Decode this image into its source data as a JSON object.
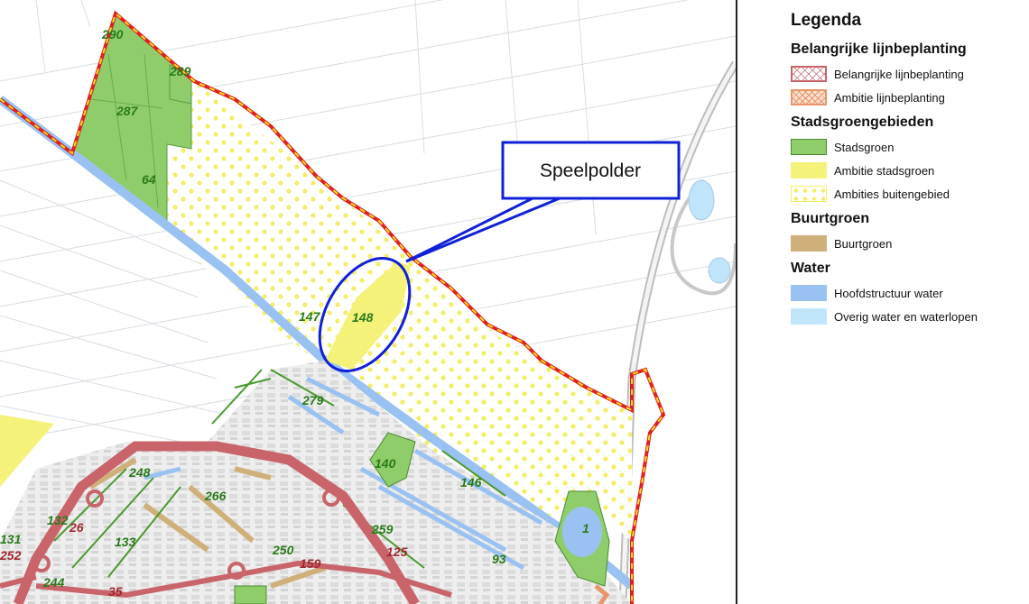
{
  "map": {
    "callout": "Speelpolder",
    "area_labels": [
      {
        "text": "290",
        "kind": "green"
      },
      {
        "text": "289",
        "kind": "green"
      },
      {
        "text": "287",
        "kind": "green"
      },
      {
        "text": "64",
        "kind": "green"
      },
      {
        "text": "147",
        "kind": "green"
      },
      {
        "text": "148",
        "kind": "green"
      },
      {
        "text": "279",
        "kind": "green"
      },
      {
        "text": "140",
        "kind": "green"
      },
      {
        "text": "146",
        "kind": "green"
      },
      {
        "text": "1",
        "kind": "green"
      },
      {
        "text": "248",
        "kind": "green"
      },
      {
        "text": "266",
        "kind": "green"
      },
      {
        "text": "132",
        "kind": "green"
      },
      {
        "text": "26",
        "kind": "red"
      },
      {
        "text": "131",
        "kind": "green"
      },
      {
        "text": "133",
        "kind": "green"
      },
      {
        "text": "259",
        "kind": "green"
      },
      {
        "text": "125",
        "kind": "red"
      },
      {
        "text": "250",
        "kind": "green"
      },
      {
        "text": "159",
        "kind": "red"
      },
      {
        "text": "93",
        "kind": "green"
      },
      {
        "text": "252",
        "kind": "red"
      },
      {
        "text": "244",
        "kind": "green"
      },
      {
        "text": "35",
        "kind": "red"
      }
    ]
  },
  "legend": {
    "title": "Legenda",
    "sections": [
      {
        "heading": "Belangrijke lijnbeplanting",
        "items": [
          {
            "label": "Belangrijke lijnbeplanting",
            "swatch": "hatch-red"
          },
          {
            "label": "Ambitie lijnbeplanting",
            "swatch": "hatch-orange"
          }
        ]
      },
      {
        "heading": "Stadsgroengebieden",
        "items": [
          {
            "label": "Stadsgroen",
            "swatch": "#8fcd6b"
          },
          {
            "label": "Ambitie stadsgroen",
            "swatch": "#f5f27a"
          },
          {
            "label": "Ambities buitengebied",
            "swatch": "dots-yellow"
          }
        ]
      },
      {
        "heading": "Buurtgroen",
        "items": [
          {
            "label": "Buurtgroen",
            "swatch": "#d0b07a"
          }
        ]
      },
      {
        "heading": "Water",
        "items": [
          {
            "label": "Hoofdstructuur water",
            "swatch": "#99c2f2"
          },
          {
            "label": "Overig water en waterlopen",
            "swatch": "#c0e5fa"
          }
        ]
      }
    ]
  },
  "colors": {
    "stadsgroen": "#8fcd6b",
    "ambitie_stadsgroen": "#f5f27a",
    "buitengebied_dot": "#f3ee66",
    "buurtgroen": "#d0b07a",
    "water_main": "#99c2f2",
    "water_other": "#c0e5fa",
    "boundary_red": "#e02020",
    "boundary_yellow": "#f5e020",
    "line_planting": "#c8646a",
    "callout_blue": "#1020d8",
    "label_green": "#2a7a1a",
    "label_red": "#a02830"
  }
}
